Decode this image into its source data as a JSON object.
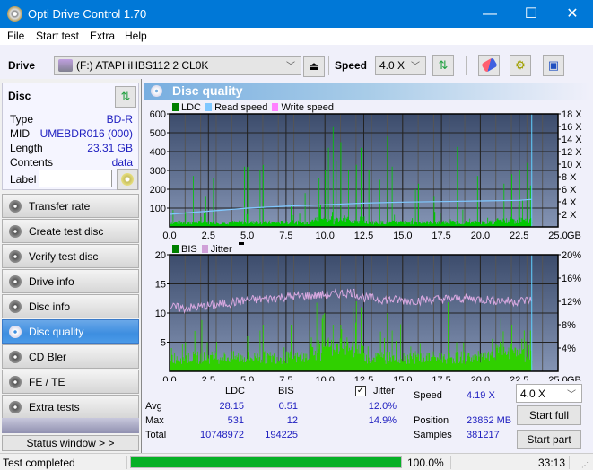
{
  "window": {
    "title": "Opti Drive Control 1.70",
    "controls": {
      "minimize": "—",
      "maximize": "☐",
      "close": "✕"
    }
  },
  "menu": [
    "File",
    "Start test",
    "Extra",
    "Help"
  ],
  "toolbar": {
    "drive_label": "Drive",
    "drive_value": "(F:)  ATAPI iHBS112  2 CL0K",
    "speed_label": "Speed",
    "speed_value": "4.0 X",
    "icons": [
      "eject-icon",
      "refresh-icon",
      "erase-icon",
      "settings-icon",
      "save-icon"
    ]
  },
  "disc": {
    "header": "Disc",
    "fields": [
      {
        "key": "Type",
        "value": "BD-R"
      },
      {
        "key": "MID",
        "value": "UMEBDR016 (000)"
      },
      {
        "key": "Length",
        "value": "23.31 GB"
      },
      {
        "key": "Contents",
        "value": "data"
      }
    ],
    "label_key": "Label",
    "label_value": ""
  },
  "nav": [
    {
      "label": "Transfer rate",
      "active": false
    },
    {
      "label": "Create test disc",
      "active": false
    },
    {
      "label": "Verify test disc",
      "active": false
    },
    {
      "label": "Drive info",
      "active": false
    },
    {
      "label": "Disc info",
      "active": false
    },
    {
      "label": "Disc quality",
      "active": true
    },
    {
      "label": "CD Bler",
      "active": false
    },
    {
      "label": "FE / TE",
      "active": false
    },
    {
      "label": "Extra tests",
      "active": false
    }
  ],
  "status_window_label": "Status window > >",
  "panel_title": "Disc quality",
  "colors": {
    "ldc": "#008000",
    "read_speed": "#80c8ff",
    "write_speed": "#ff80ff",
    "bis": "#008000",
    "jitter": "#d0a0d8",
    "bar_fill": "#00cc00",
    "plot_bg_top": "#3c4c6c",
    "plot_bg_bottom": "#8090b0",
    "progress": "#06b025",
    "accent": "#0078d7"
  },
  "chart_data": [
    {
      "type": "bar",
      "title": "LDC / Read speed",
      "legend": [
        "LDC",
        "Read speed",
        "Write speed"
      ],
      "legend_position": "top-left",
      "xlabel": "GB",
      "x_ticks": [
        "0.0",
        "2.5",
        "5.0",
        "7.5",
        "10.0",
        "12.5",
        "15.0",
        "17.5",
        "20.0",
        "22.5",
        "25.0"
      ],
      "xlim": [
        0,
        25
      ],
      "y_ticks": [
        "100",
        "200",
        "300",
        "400",
        "500",
        "600"
      ],
      "ylim": [
        0,
        600
      ],
      "y2_ticks": [
        "2 X",
        "4 X",
        "6 X",
        "8 X",
        "10 X",
        "12 X",
        "14 X",
        "16 X",
        "18 X"
      ],
      "y2lim": [
        0,
        18
      ],
      "grid": true,
      "end_marker_gb": 23.31,
      "ldc_peaks": [
        {
          "x": 0.2,
          "y": 90
        },
        {
          "x": 1.0,
          "y": 80
        },
        {
          "x": 1.5,
          "y": 270
        },
        {
          "x": 2.3,
          "y": 160
        },
        {
          "x": 2.8,
          "y": 260
        },
        {
          "x": 4.8,
          "y": 320
        },
        {
          "x": 5.0,
          "y": 140
        },
        {
          "x": 5.8,
          "y": 300
        },
        {
          "x": 6.0,
          "y": 330
        },
        {
          "x": 7.8,
          "y": 120
        },
        {
          "x": 8.7,
          "y": 180
        },
        {
          "x": 9.0,
          "y": 200
        },
        {
          "x": 9.6,
          "y": 260
        },
        {
          "x": 10.0,
          "y": 300
        },
        {
          "x": 10.2,
          "y": 420
        },
        {
          "x": 10.5,
          "y": 530
        },
        {
          "x": 10.7,
          "y": 350
        },
        {
          "x": 11.0,
          "y": 450
        },
        {
          "x": 11.5,
          "y": 300
        },
        {
          "x": 12.0,
          "y": 330
        },
        {
          "x": 12.3,
          "y": 420
        },
        {
          "x": 12.8,
          "y": 300
        },
        {
          "x": 13.5,
          "y": 250
        },
        {
          "x": 14.0,
          "y": 480
        },
        {
          "x": 14.3,
          "y": 320
        },
        {
          "x": 15.8,
          "y": 200
        },
        {
          "x": 16.0,
          "y": 230
        },
        {
          "x": 17.0,
          "y": 160
        },
        {
          "x": 18.5,
          "y": 160
        },
        {
          "x": 19.8,
          "y": 270
        },
        {
          "x": 21.5,
          "y": 230
        },
        {
          "x": 22.0,
          "y": 280
        },
        {
          "x": 22.5,
          "y": 300
        },
        {
          "x": 23.0,
          "y": 340
        },
        {
          "x": 23.2,
          "y": 220
        }
      ],
      "ldc_baseline": 25,
      "read_speed": [
        {
          "x": 0,
          "y": 2.0
        },
        {
          "x": 1.7,
          "y": 2.35
        },
        {
          "x": 3.5,
          "y": 2.7
        },
        {
          "x": 5.0,
          "y": 3.0
        },
        {
          "x": 7.5,
          "y": 3.3
        },
        {
          "x": 10.0,
          "y": 3.55
        },
        {
          "x": 12.5,
          "y": 3.8
        },
        {
          "x": 15.0,
          "y": 3.95
        },
        {
          "x": 17.5,
          "y": 4.05
        },
        {
          "x": 20.0,
          "y": 4.15
        },
        {
          "x": 22.5,
          "y": 4.25
        },
        {
          "x": 23.31,
          "y": 4.4
        }
      ]
    },
    {
      "type": "bar",
      "title": "BIS / Jitter",
      "legend": [
        "BIS",
        "Jitter"
      ],
      "legend_position": "top-left",
      "xlabel": "GB",
      "x_ticks": [
        "0.0",
        "2.5",
        "5.0",
        "7.5",
        "10.0",
        "12.5",
        "15.0",
        "17.5",
        "20.0",
        "22.5",
        "25.0"
      ],
      "xlim": [
        0,
        25
      ],
      "y_ticks": [
        "5",
        "10",
        "15",
        "20"
      ],
      "ylim": [
        0,
        20
      ],
      "y2_ticks": [
        "4%",
        "8%",
        "12%",
        "16%",
        "20%"
      ],
      "y2lim": [
        0,
        20
      ],
      "grid": true,
      "end_marker_gb": 23.31,
      "bis_peaks": [
        {
          "x": 0.1,
          "y": 4
        },
        {
          "x": 1.0,
          "y": 5
        },
        {
          "x": 2.4,
          "y": 5
        },
        {
          "x": 5.0,
          "y": 6
        },
        {
          "x": 5.8,
          "y": 7
        },
        {
          "x": 6.0,
          "y": 8
        },
        {
          "x": 7.8,
          "y": 8
        },
        {
          "x": 9.0,
          "y": 7
        },
        {
          "x": 9.8,
          "y": 9
        },
        {
          "x": 10.5,
          "y": 8
        },
        {
          "x": 11.0,
          "y": 8
        },
        {
          "x": 11.8,
          "y": 11
        },
        {
          "x": 12.0,
          "y": 12
        },
        {
          "x": 12.3,
          "y": 11
        },
        {
          "x": 14.0,
          "y": 10
        },
        {
          "x": 14.3,
          "y": 7
        },
        {
          "x": 21.3,
          "y": 9
        },
        {
          "x": 22.0,
          "y": 8
        },
        {
          "x": 22.8,
          "y": 7
        },
        {
          "x": 23.2,
          "y": 7
        }
      ],
      "bis_baseline": 2.5,
      "jitter": [
        {
          "x": 0,
          "y": 11.0
        },
        {
          "x": 1.0,
          "y": 10.8
        },
        {
          "x": 2.5,
          "y": 11.2
        },
        {
          "x": 4.0,
          "y": 11.8
        },
        {
          "x": 5.0,
          "y": 12.2
        },
        {
          "x": 6.0,
          "y": 12.4
        },
        {
          "x": 7.5,
          "y": 12.8
        },
        {
          "x": 9.0,
          "y": 13.0
        },
        {
          "x": 10.5,
          "y": 13.2
        },
        {
          "x": 11.8,
          "y": 13.6
        },
        {
          "x": 12.5,
          "y": 12.6
        },
        {
          "x": 14.0,
          "y": 12.3
        },
        {
          "x": 15.5,
          "y": 12.1
        },
        {
          "x": 17.5,
          "y": 12.4
        },
        {
          "x": 19.0,
          "y": 12.5
        },
        {
          "x": 20.5,
          "y": 12.3
        },
        {
          "x": 22.0,
          "y": 12.0
        },
        {
          "x": 23.31,
          "y": 12.2
        }
      ]
    }
  ],
  "stats": {
    "col_headers": [
      "LDC",
      "BIS"
    ],
    "rows": [
      {
        "label": "Avg",
        "ldc": "28.15",
        "bis": "0.51",
        "jitter": "12.0%"
      },
      {
        "label": "Max",
        "ldc": "531",
        "bis": "12",
        "jitter": "14.9%"
      },
      {
        "label": "Total",
        "ldc": "10748972",
        "bis": "194225",
        "jitter": ""
      }
    ],
    "jitter_label": "Jitter",
    "jitter_checked": true,
    "speed_label": "Speed",
    "speed_value": "4.19 X",
    "position_label": "Position",
    "position_value": "23862 MB",
    "samples_label": "Samples",
    "samples_value": "381217",
    "speed_select": "4.0 X",
    "start_full": "Start full",
    "start_part": "Start part"
  },
  "statusbar": {
    "text": "Test completed",
    "progress_percent": 100.0,
    "progress_label": "100.0%",
    "elapsed": "33:13"
  }
}
